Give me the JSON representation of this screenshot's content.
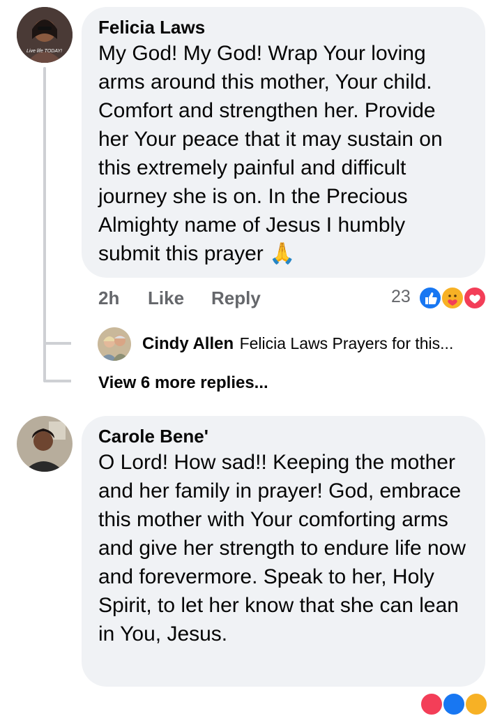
{
  "comments": [
    {
      "author": "Felicia Laws",
      "avatar_caption": "Live life TODAY!",
      "text": "My God! My God! Wrap Your loving arms around this mother, Your child. Comfort and strengthen her. Provide her Your peace that it may sustain on this extremely painful and difficult journey she is on. In the Precious Almighty name of Jesus I humbly submit this prayer 🙏",
      "time": "2h",
      "like_label": "Like",
      "reply_label": "Reply",
      "reaction_count": "23",
      "reactions": [
        "like-icon",
        "care-icon",
        "love-icon"
      ],
      "reply": {
        "author": "Cindy Allen",
        "preview": "Felicia Laws Prayers for this..."
      },
      "view_more": "View 6 more replies..."
    },
    {
      "author": "Carole Bene'",
      "text": "O Lord! How sad!! Keeping the mother and her family in prayer! God, embrace this mother with Your comforting arms and give her strength to endure life now and forevermore. Speak to her, Holy Spirit, to let her know that she can lean in You, Jesus."
    }
  ],
  "colors": {
    "bubble": "#f0f2f5",
    "meta_text": "#65676b",
    "like_blue": "#1877f2",
    "love_red": "#f33e58",
    "care_yellow": "#f7b125"
  }
}
